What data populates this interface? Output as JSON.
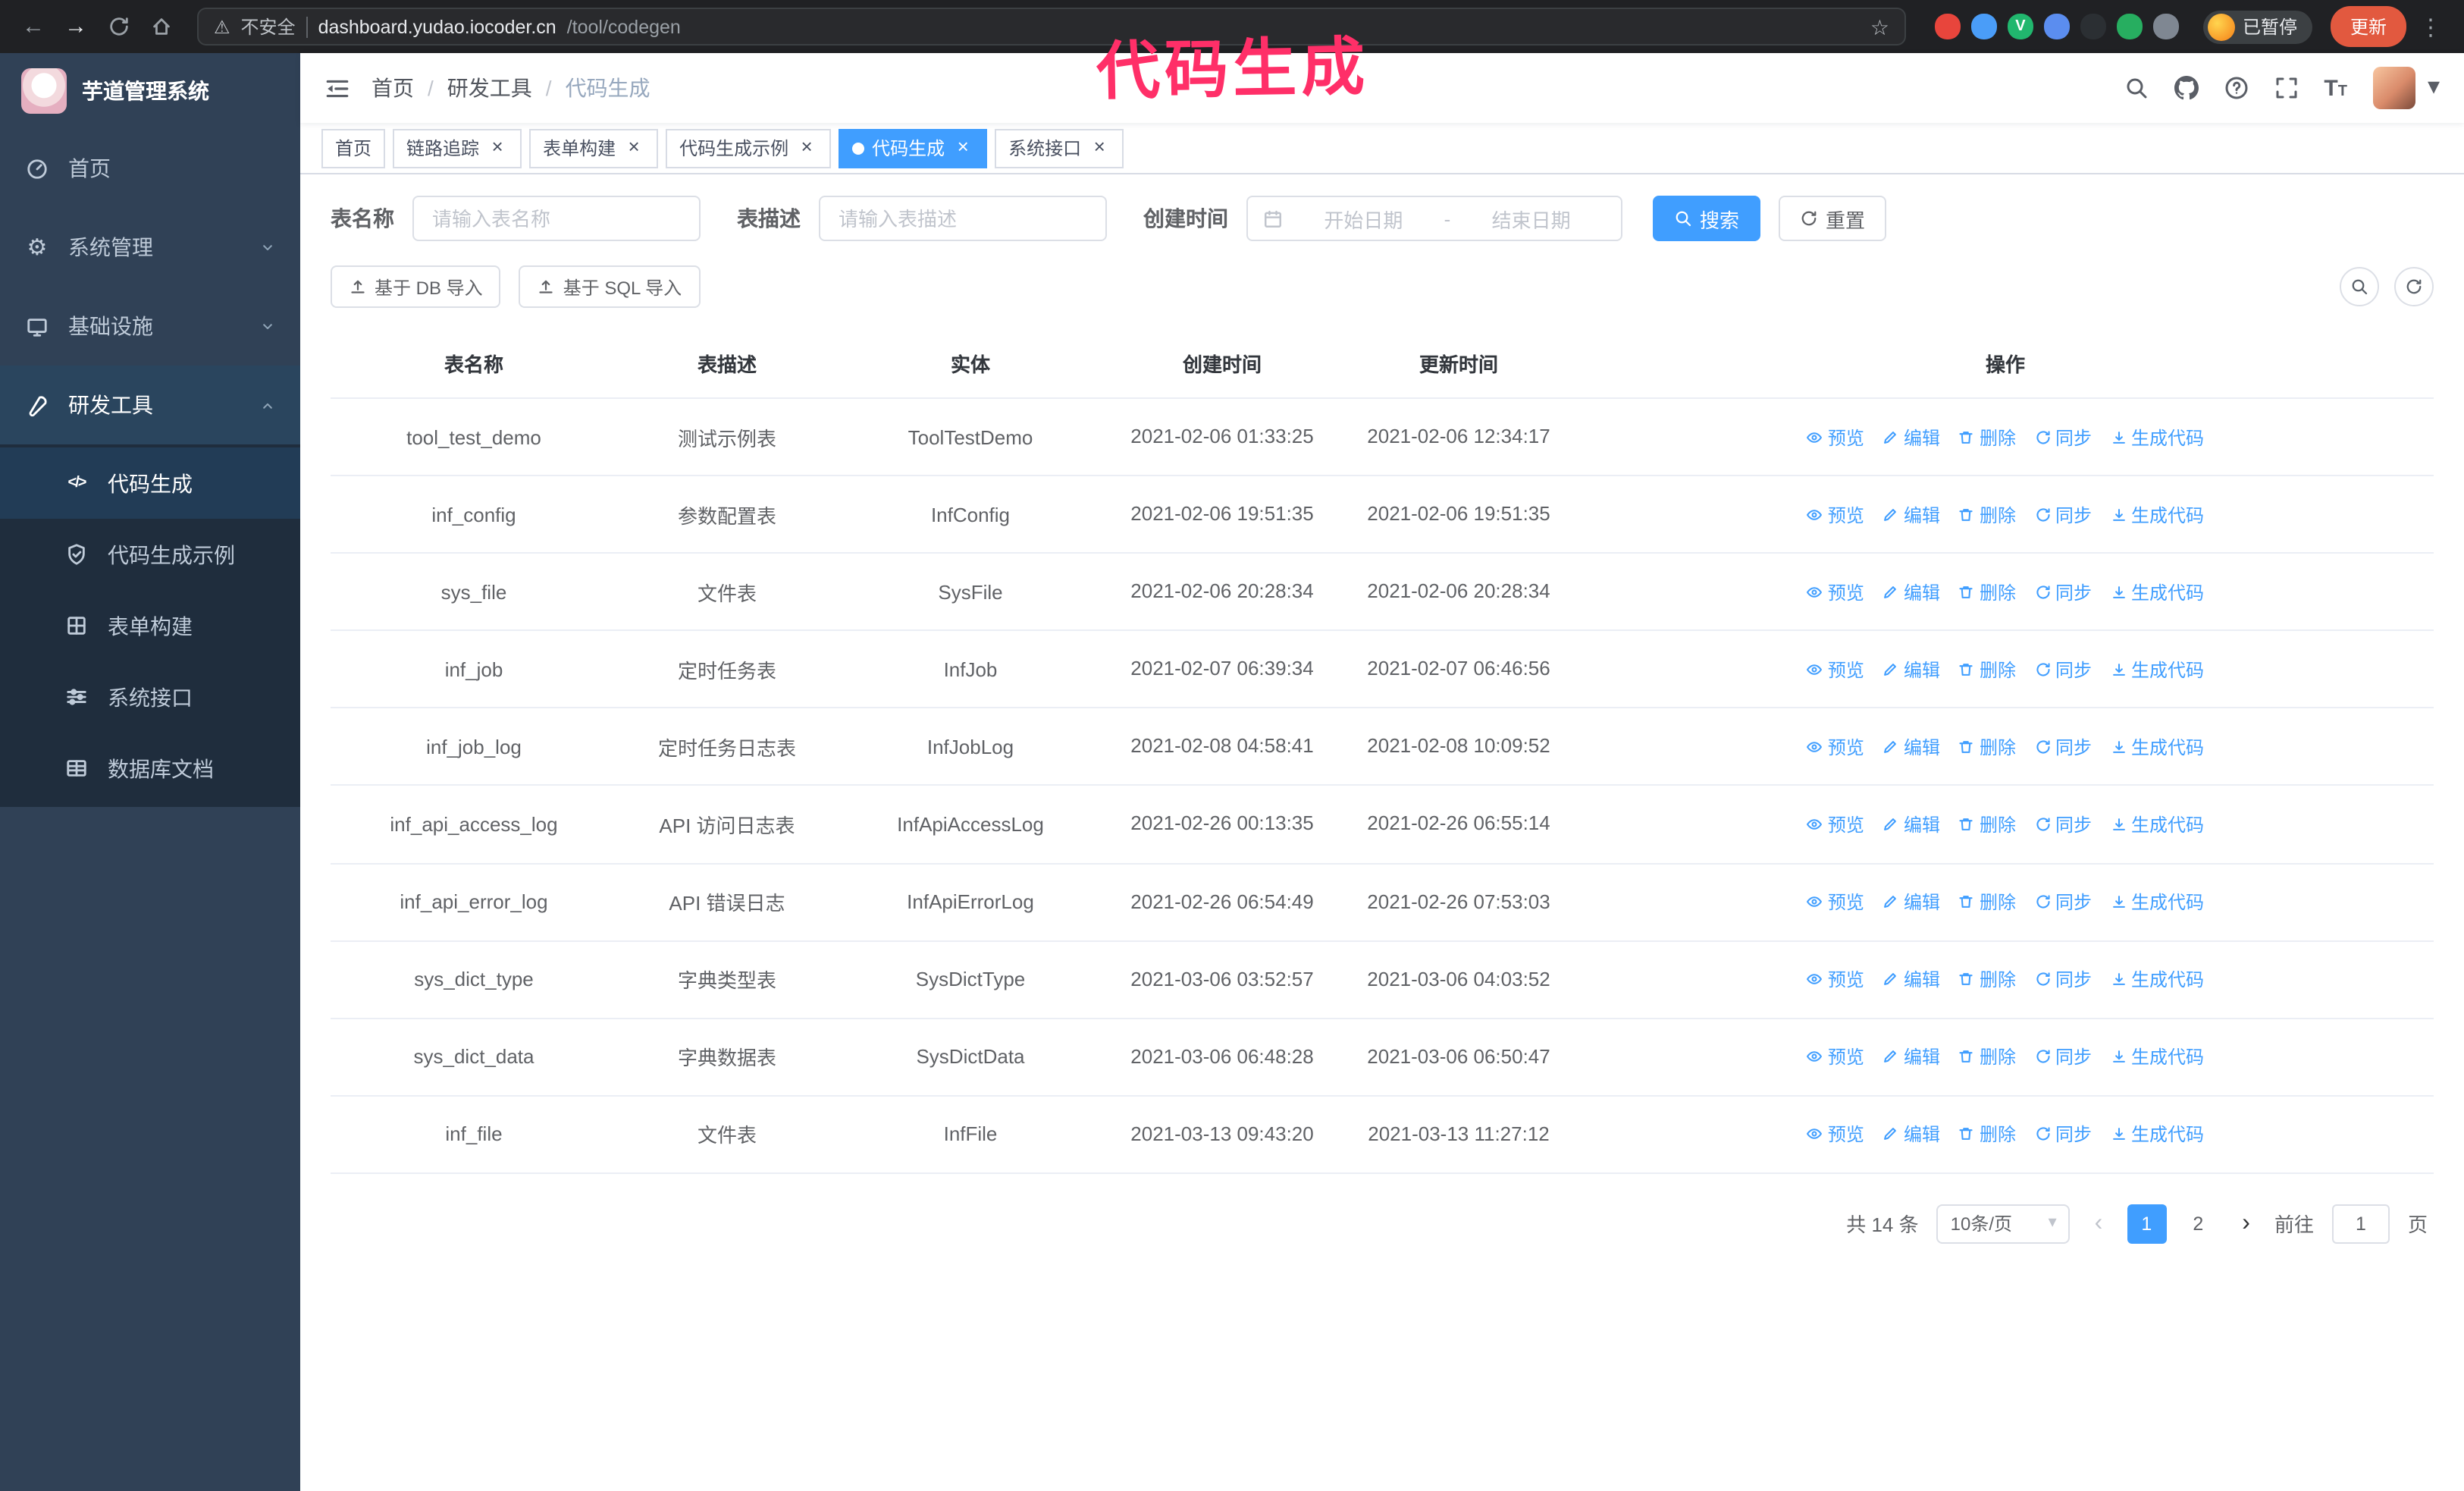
{
  "annotation": {
    "text": "代码生成",
    "color": "#ff2f68"
  },
  "browser": {
    "security_label": "不安全",
    "url_host": "dashboard.yudao.iocoder.cn",
    "url_path": "/tool/codegen",
    "paused_badge": "已暂停",
    "update_button": "更新",
    "extensions": [
      {
        "name": "ext-flame",
        "color": "#e8453c"
      },
      {
        "name": "ext-drop",
        "color": "#4a9df8"
      },
      {
        "name": "ext-vue",
        "color": "#21b76e",
        "glyph": "V"
      },
      {
        "name": "ext-users",
        "color": "#5b8def"
      },
      {
        "name": "ext-screenshot",
        "color": "#2b2f33"
      },
      {
        "name": "ext-green",
        "color": "#27ae60"
      },
      {
        "name": "ext-puzzle",
        "color": "#7f8792"
      }
    ]
  },
  "sidebar": {
    "logo_title": "芋道管理系统",
    "items": [
      {
        "key": "home",
        "label": "首页",
        "icon": "dashboard-icon",
        "expandable": false
      },
      {
        "key": "system",
        "label": "系统管理",
        "icon": "gear-icon",
        "expandable": true,
        "open": false
      },
      {
        "key": "infra",
        "label": "基础设施",
        "icon": "monitor-icon",
        "expandable": true,
        "open": false
      },
      {
        "key": "devtools",
        "label": "研发工具",
        "icon": "tool-icon",
        "expandable": true,
        "open": true,
        "children": [
          {
            "key": "codegen",
            "label": "代码生成",
            "icon": "code-icon",
            "active": true
          },
          {
            "key": "codegen-demo",
            "label": "代码生成示例",
            "icon": "shield-check-icon"
          },
          {
            "key": "form-build",
            "label": "表单构建",
            "icon": "grid-icon"
          },
          {
            "key": "api",
            "label": "系统接口",
            "icon": "sliders-icon"
          },
          {
            "key": "db-doc",
            "label": "数据库文档",
            "icon": "table-icon"
          }
        ]
      }
    ]
  },
  "header": {
    "breadcrumb": [
      "首页",
      "研发工具",
      "代码生成"
    ],
    "breadcrumb_separator": "/"
  },
  "tabs": [
    {
      "key": "home",
      "label": "首页",
      "closable": false,
      "active": false
    },
    {
      "key": "tracing",
      "label": "链路追踪",
      "closable": true,
      "active": false
    },
    {
      "key": "form-build",
      "label": "表单构建",
      "closable": true,
      "active": false
    },
    {
      "key": "codegen-demo",
      "label": "代码生成示例",
      "closable": true,
      "active": false
    },
    {
      "key": "codegen",
      "label": "代码生成",
      "closable": true,
      "active": true
    },
    {
      "key": "api",
      "label": "系统接口",
      "closable": true,
      "active": false
    }
  ],
  "filters": {
    "name_label": "表名称",
    "name_placeholder": "请输入表名称",
    "desc_label": "表描述",
    "desc_placeholder": "请输入表描述",
    "time_label": "创建时间",
    "time_start_placeholder": "开始日期",
    "time_separator": "-",
    "time_end_placeholder": "结束日期",
    "search_button": "搜索",
    "reset_button": "重置"
  },
  "toolbar": {
    "import_db": "基于 DB 导入",
    "import_sql": "基于 SQL 导入"
  },
  "table": {
    "columns": [
      "表名称",
      "表描述",
      "实体",
      "创建时间",
      "更新时间",
      "操作"
    ],
    "actions": [
      {
        "key": "preview",
        "label": "预览",
        "icon": "eye-icon"
      },
      {
        "key": "edit",
        "label": "编辑",
        "icon": "edit-icon"
      },
      {
        "key": "delete",
        "label": "删除",
        "icon": "delete-icon"
      },
      {
        "key": "sync",
        "label": "同步",
        "icon": "sync-icon"
      },
      {
        "key": "generate",
        "label": "生成代码",
        "icon": "download-icon"
      }
    ],
    "rows": [
      {
        "name": "tool_test_demo",
        "desc": "测试示例表",
        "entity": "ToolTestDemo",
        "created": "2021-02-06 01:33:25",
        "updated": "2021-02-06 12:34:17"
      },
      {
        "name": "inf_config",
        "desc": "参数配置表",
        "entity": "InfConfig",
        "created": "2021-02-06 19:51:35",
        "updated": "2021-02-06 19:51:35"
      },
      {
        "name": "sys_file",
        "desc": "文件表",
        "entity": "SysFile",
        "created": "2021-02-06 20:28:34",
        "updated": "2021-02-06 20:28:34"
      },
      {
        "name": "inf_job",
        "desc": "定时任务表",
        "entity": "InfJob",
        "created": "2021-02-07 06:39:34",
        "updated": "2021-02-07 06:46:56"
      },
      {
        "name": "inf_job_log",
        "desc": "定时任务日志表",
        "entity": "InfJobLog",
        "created": "2021-02-08 04:58:41",
        "updated": "2021-02-08 10:09:52"
      },
      {
        "name": "inf_api_access_log",
        "desc": "API 访问日志表",
        "entity": "InfApiAccessLog",
        "created": "2021-02-26 00:13:35",
        "updated": "2021-02-26 06:55:14"
      },
      {
        "name": "inf_api_error_log",
        "desc": "API 错误日志",
        "entity": "InfApiErrorLog",
        "created": "2021-02-26 06:54:49",
        "updated": "2021-02-26 07:53:03"
      },
      {
        "name": "sys_dict_type",
        "desc": "字典类型表",
        "entity": "SysDictType",
        "created": "2021-03-06 03:52:57",
        "updated": "2021-03-06 04:03:52"
      },
      {
        "name": "sys_dict_data",
        "desc": "字典数据表",
        "entity": "SysDictData",
        "created": "2021-03-06 06:48:28",
        "updated": "2021-03-06 06:50:47"
      },
      {
        "name": "inf_file",
        "desc": "文件表",
        "entity": "InfFile",
        "created": "2021-03-13 09:43:20",
        "updated": "2021-03-13 11:27:12"
      }
    ]
  },
  "pagination": {
    "total_text": "共 14 条",
    "page_size": "10条/页",
    "pages": [
      {
        "label": "1",
        "active": true
      },
      {
        "label": "2",
        "active": false
      }
    ],
    "goto_label": "前往",
    "goto_value": "1",
    "goto_suffix": "页"
  },
  "colors": {
    "primary": "#409eff",
    "sidebar_bg": "#304156",
    "submenu_bg": "#1f2d3d",
    "annotation": "#ff2f68",
    "update_button": "#e2593f"
  }
}
